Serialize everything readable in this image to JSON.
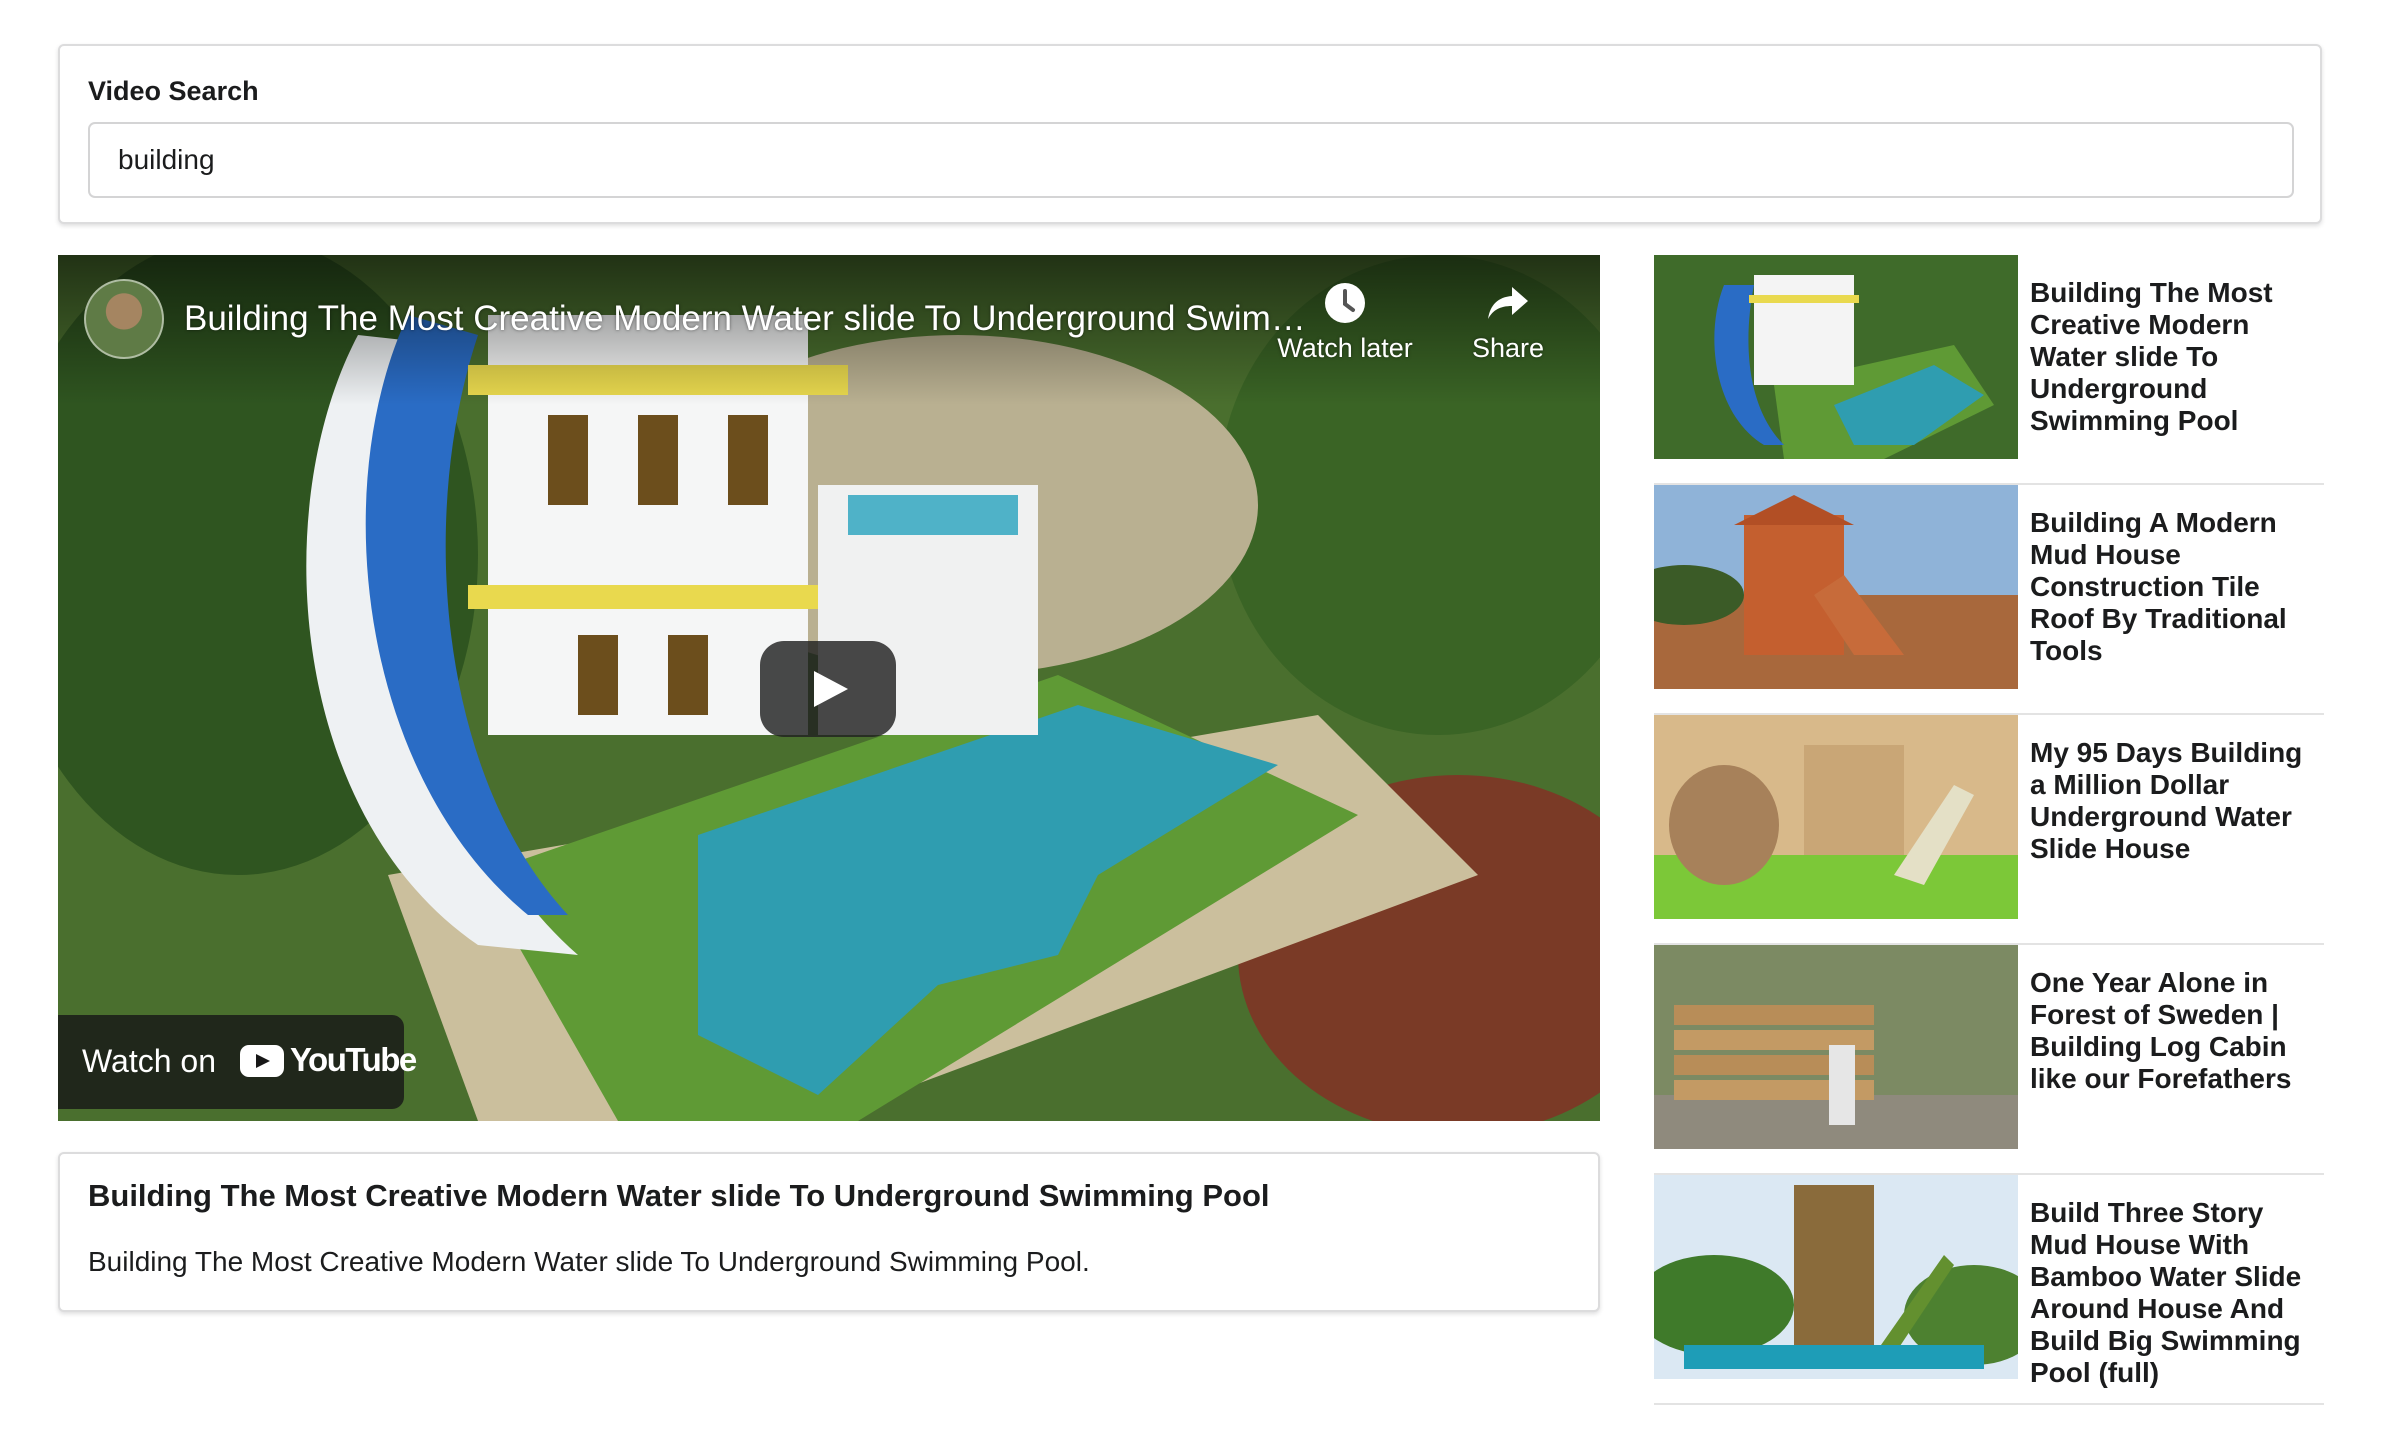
{
  "search": {
    "label": "Video Search",
    "value": "building"
  },
  "player": {
    "title": "Building The Most Creative Modern Water slide To Underground Swimming Pool",
    "watch_later_label": "Watch later",
    "share_label": "Share",
    "watch_on_label": "Watch on",
    "brand_label": "YouTube",
    "icons": [
      "channel-avatar",
      "clock-icon",
      "share-arrow-icon",
      "play-icon",
      "youtube-logo-icon"
    ]
  },
  "details": {
    "title": "Building The Most Creative Modern Water slide To Underground Swimming Pool",
    "description": "Building The Most Creative Modern Water slide To Underground Swimming Pool."
  },
  "video_list": [
    {
      "title": "Building The Most Creative Modern Water slide To Underground Swimming Pool"
    },
    {
      "title": "Building A Modern Mud House Construction Tile Roof By Traditional Tools"
    },
    {
      "title": "My 95 Days Building a Million Dollar Underground Water Slide House"
    },
    {
      "title": "One Year Alone in Forest of Sweden | Building Log Cabin like our Forefathers"
    },
    {
      "title": "Build Three Story Mud House With Bamboo Water Slide Around House And Build Big Swimming Pool (full)"
    }
  ],
  "colors": {
    "border": "#dcdcdd",
    "text": "#1b1c1d",
    "overlay": "#171717"
  }
}
